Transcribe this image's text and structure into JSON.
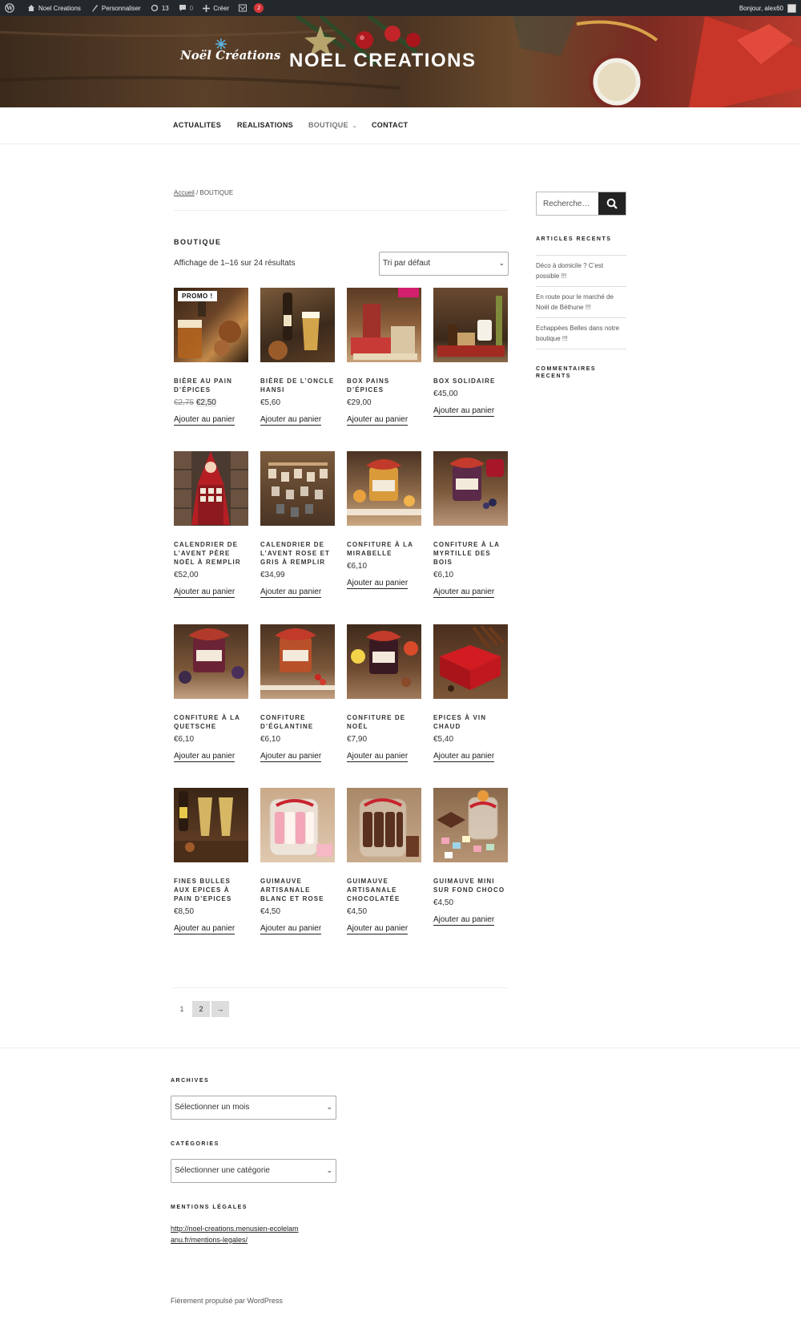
{
  "admin_bar": {
    "site_name": "Noel Creations",
    "customize": "Personnaliser",
    "updates_count": "13",
    "comments_count": "0",
    "new_label": "Créer",
    "plugin_badge": "2",
    "greeting": "Bonjour, alex60"
  },
  "header": {
    "logo_text": "Noël Créations",
    "site_title": "NOEL CREATIONS"
  },
  "nav": {
    "items": [
      "ACTUALITES",
      "REALISATIONS",
      "BOUTIQUE",
      "CONTACT"
    ],
    "active": "BOUTIQUE"
  },
  "breadcrumb": {
    "home": "Accueil",
    "current": "/ BOUTIQUE"
  },
  "shop": {
    "title": "BOUTIQUE",
    "result_count": "Affichage de 1–16 sur 24 résultats",
    "orderby": "Tri par défaut",
    "add_to_cart_label": "Ajouter au panier",
    "products": [
      {
        "name": "BIÈRE AU PAIN D’ÉPICES",
        "old_price": "€2,75",
        "price": "€2,50",
        "promo": "PROMO !"
      },
      {
        "name": "BIÈRE DE L’ONCLE HANSI",
        "price": "€5,60"
      },
      {
        "name": "BOX PAINS D’ÉPICES",
        "price": "€29,00"
      },
      {
        "name": "BOX SOLIDAIRE",
        "price": "€45,00"
      },
      {
        "name": "CALENDRIER DE L’AVENT PÈRE NOËL À REMPLIR",
        "price": "€52,00"
      },
      {
        "name": "CALENDRIER DE L’AVENT ROSE ET GRIS À REMPLIR",
        "price": "€34,99"
      },
      {
        "name": "CONFITURE À LA MIRABELLE",
        "price": "€6,10"
      },
      {
        "name": "CONFITURE À LA MYRTILLE DES BOIS",
        "price": "€6,10"
      },
      {
        "name": "CONFITURE À LA QUETSCHE",
        "price": "€6,10"
      },
      {
        "name": "CONFITURE D’ÉGLANTINE",
        "price": "€6,10"
      },
      {
        "name": "CONFITURE DE NOËL",
        "price": "€7,90"
      },
      {
        "name": "EPICES À VIN CHAUD",
        "price": "€5,40"
      },
      {
        "name": "FINES BULLES AUX EPICES À PAIN D’EPICES",
        "price": "€8,50"
      },
      {
        "name": "GUIMAUVE ARTISANALE BLANC ET ROSE",
        "price": "€4,50"
      },
      {
        "name": "GUIMAUVE ARTISANALE CHOCOLATÉE",
        "price": "€4,50"
      },
      {
        "name": "GUIMAUVE MINI SUR FOND CHOCO",
        "price": "€4,50"
      }
    ],
    "pagination": {
      "page1": "1",
      "page2": "2",
      "next": "→"
    }
  },
  "sidebar": {
    "search_placeholder": "Recherche…",
    "recent_title": "ARTICLES RECENTS",
    "recent_posts": [
      "Déco à domicile ? C’est possible !!!",
      "En route pour le marché de Noël de Béthune !!!",
      "Echappées Belles dans notre boutique !!!"
    ],
    "comments_title": "COMMENTAIRES RECENTS"
  },
  "footer": {
    "archives_title": "ARCHIVES",
    "archives_select": "Sélectionner un mois",
    "categories_title": "CATÉGORIES",
    "categories_select": "Sélectionner une catégorie",
    "legal_title": "MENTIONS LÉGALES",
    "legal_link": "http://noel-creations.menusien-ecolelamanu.fr/mentions-legales/",
    "powered_by": "Fièrement propulsé par WordPress"
  },
  "colors": {
    "admin_bar_bg": "#23282d",
    "accent_dark": "#222222",
    "badge_red": "#d63638"
  }
}
